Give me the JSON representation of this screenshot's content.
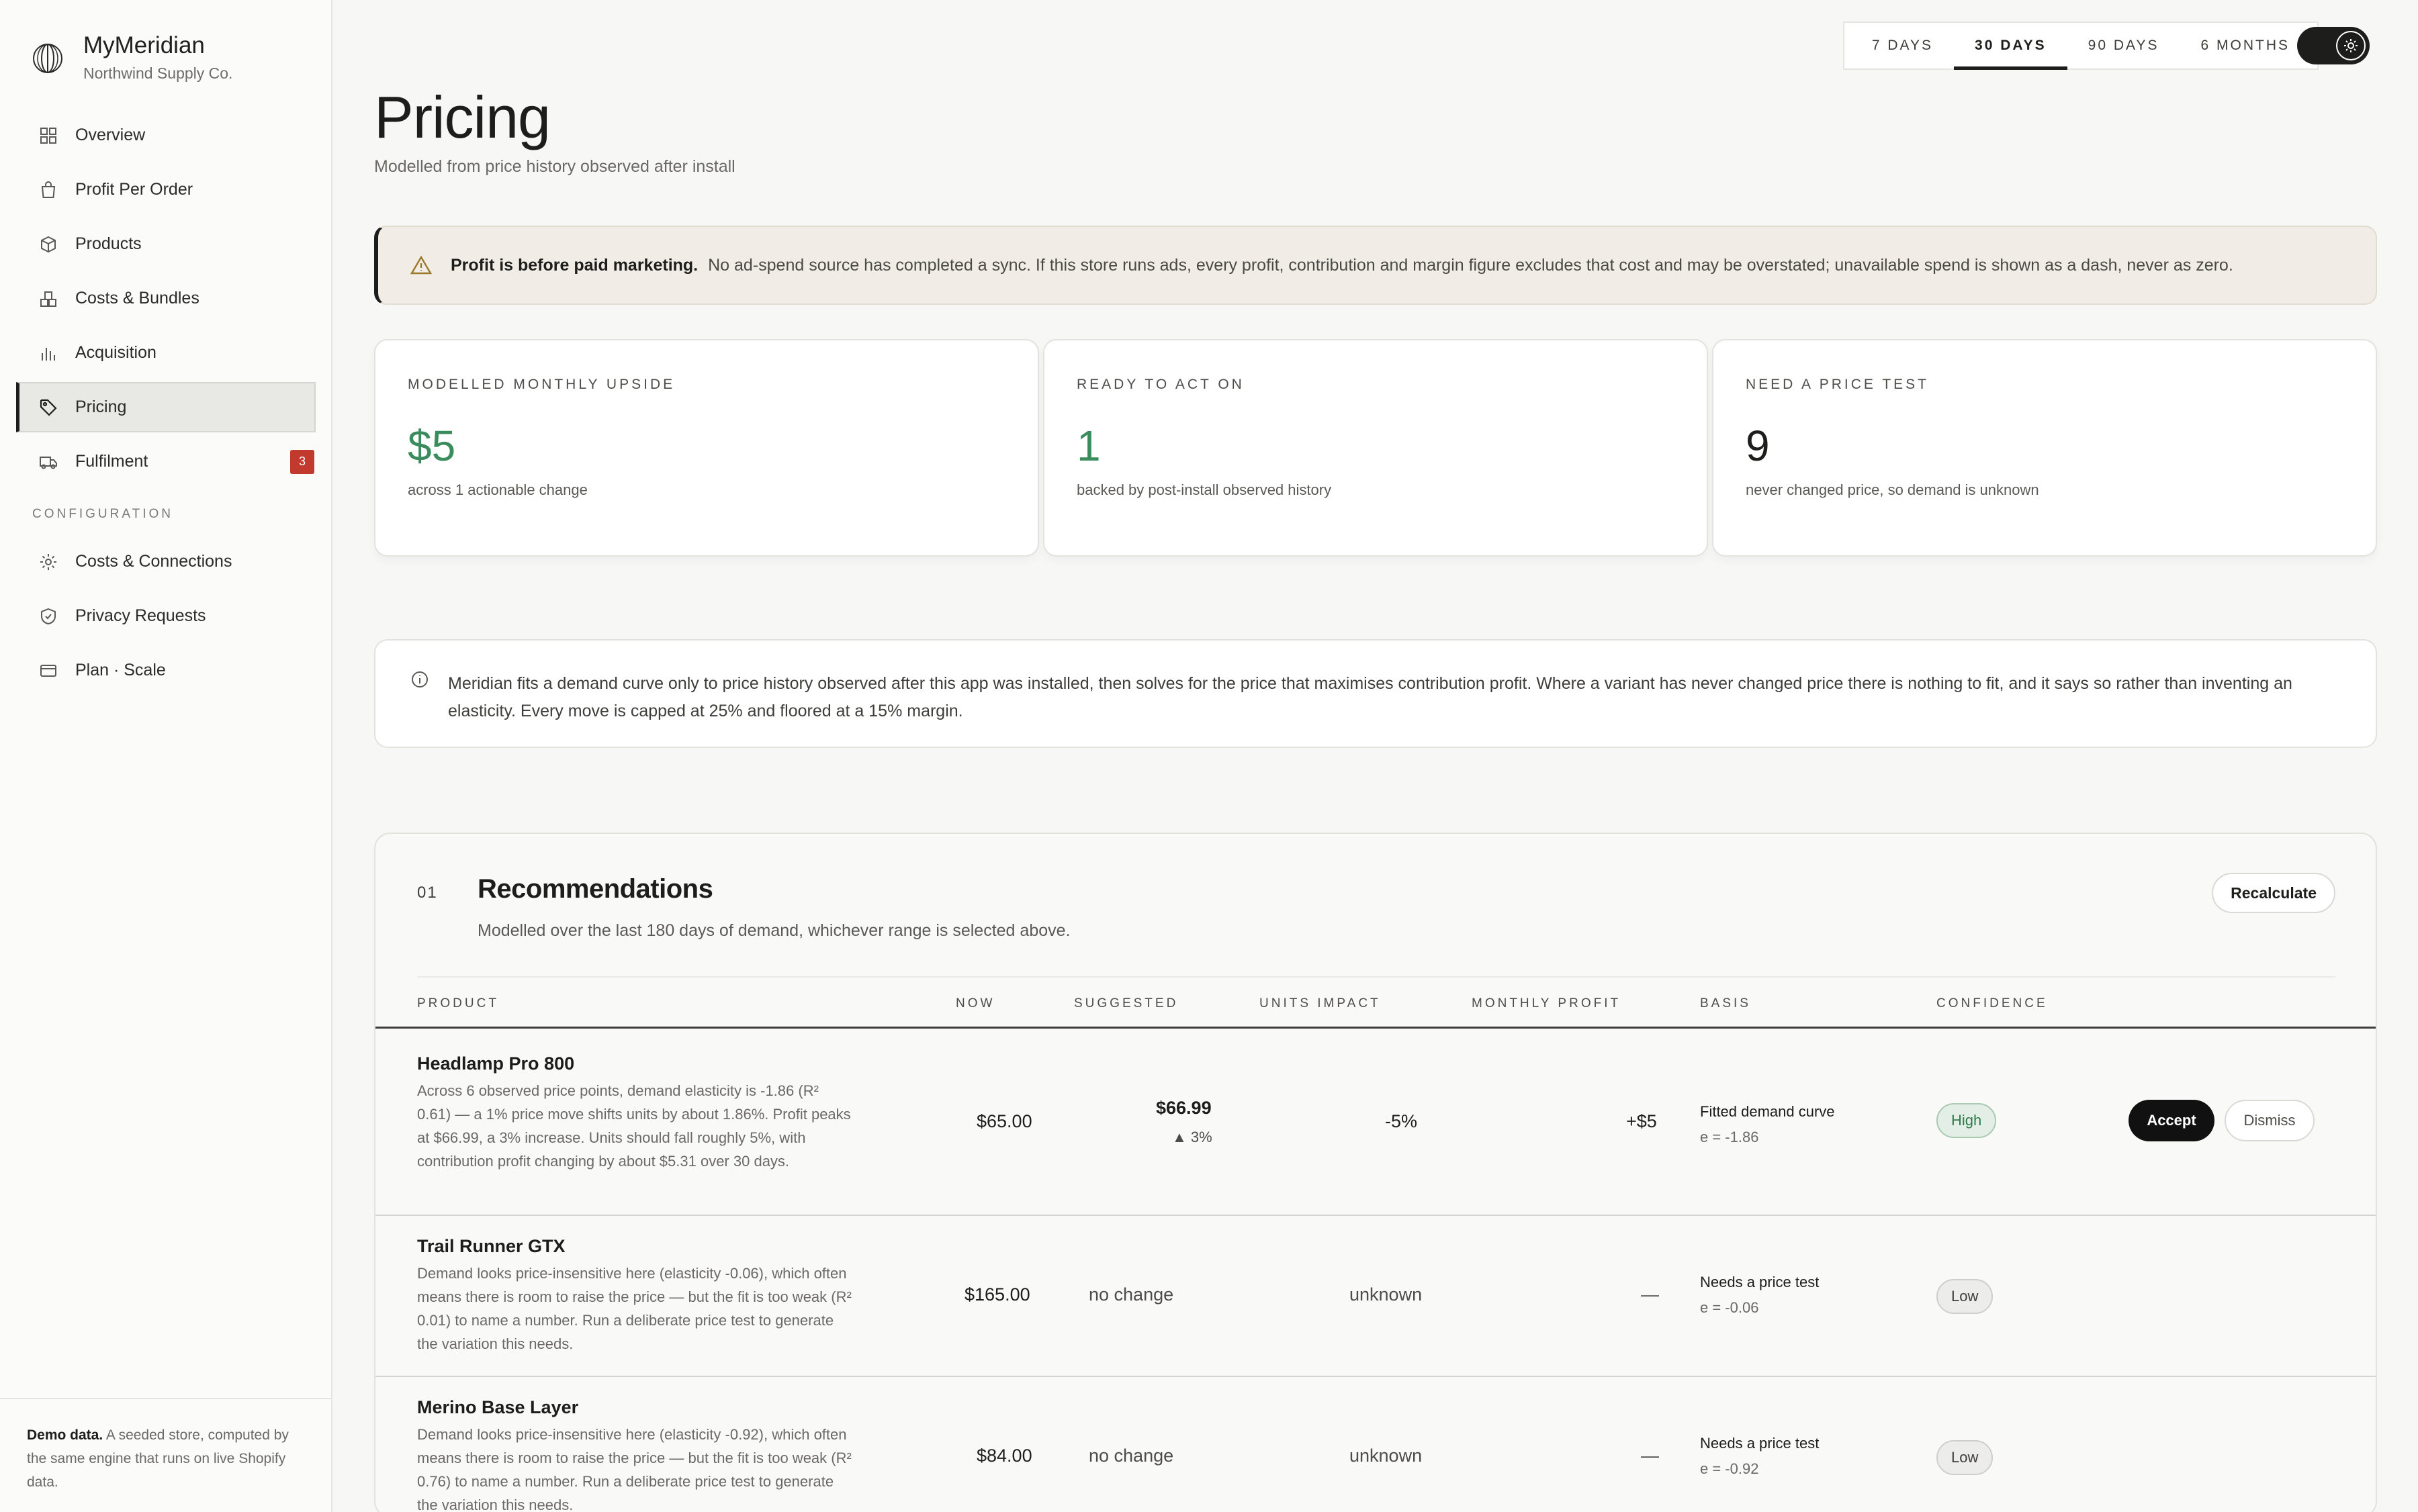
{
  "brand": {
    "name": "MyMeridian",
    "store": "Northwind Supply Co."
  },
  "nav": {
    "items": [
      {
        "label": "Overview",
        "icon": "grid-icon"
      },
      {
        "label": "Profit Per Order",
        "icon": "bag-icon"
      },
      {
        "label": "Products",
        "icon": "box-icon"
      },
      {
        "label": "Costs & Bundles",
        "icon": "stack-icon"
      },
      {
        "label": "Acquisition",
        "icon": "bars-icon"
      },
      {
        "label": "Pricing",
        "icon": "tag-icon",
        "active": true
      },
      {
        "label": "Fulfilment",
        "icon": "truck-icon",
        "badge": "3"
      }
    ],
    "config_label": "CONFIGURATION",
    "config_items": [
      {
        "label": "Costs & Connections",
        "icon": "gear-icon"
      },
      {
        "label": "Privacy Requests",
        "icon": "shield-icon"
      },
      {
        "label": "Plan · Scale",
        "icon": "card-icon"
      }
    ]
  },
  "demo": {
    "bold": "Demo data.",
    "text": "A seeded store, computed by the same engine that runs on live Shopify data."
  },
  "range": {
    "tabs": [
      "7 DAYS",
      "30 DAYS",
      "90 DAYS",
      "6 MONTHS"
    ],
    "selected": "30 DAYS"
  },
  "page": {
    "title": "Pricing",
    "subtitle": "Modelled from price history observed after install"
  },
  "alert": {
    "bold": "Profit is before paid marketing.",
    "text": "No ad-spend source has completed a sync. If this store runs ads, every profit, contribution and margin figure excludes that cost and may be overstated; unavailable spend is shown as a dash, never as zero."
  },
  "stats": [
    {
      "label": "MODELLED MONTHLY UPSIDE",
      "value": "$5",
      "note": "across 1 actionable change"
    },
    {
      "label": "READY TO ACT ON",
      "value": "1",
      "note": "backed by post-install observed history"
    },
    {
      "label": "NEED A PRICE TEST",
      "value": "9",
      "note": "never changed price, so demand is unknown"
    }
  ],
  "info": "Meridian fits a demand curve only to price history observed after this app was installed, then solves for the price that maximises contribution profit. Where a variant has never changed price there is nothing to fit, and it says so rather than inventing an elasticity. Every move is capped at 25% and floored at a 15% margin.",
  "recommendations": {
    "number": "01",
    "title": "Recommendations",
    "subtitle": "Modelled over the last 180 days of demand, whichever range is selected above.",
    "recalc_label": "Recalculate",
    "columns": [
      "PRODUCT",
      "NOW",
      "SUGGESTED",
      "UNITS IMPACT",
      "MONTHLY PROFIT",
      "BASIS",
      "CONFIDENCE"
    ],
    "rows": [
      {
        "name": "Headlamp Pro 800",
        "desc": "Across 6 observed price points, demand elasticity is -1.86 (R² 0.61) — a 1% price move shifts units by about 1.86%. Profit peaks at $66.99, a 3% increase. Units should fall roughly 5%, with contribution profit changing by about $5.31 over 30 days.",
        "now": "$65.00",
        "suggested": "$66.99",
        "change": "▲ 3%",
        "units": "-5%",
        "profit": "+$5",
        "basis": "Fitted demand curve",
        "elasticity": "e = -1.86",
        "confidence": "High",
        "accept_label": "Accept",
        "dismiss_label": "Dismiss"
      },
      {
        "name": "Trail Runner GTX",
        "desc": "Demand looks price-insensitive here (elasticity -0.06), which often means there is room to raise the price — but the fit is too weak (R² 0.01) to name a number. Run a deliberate price test to generate the variation this needs.",
        "now": "$165.00",
        "suggested": "no change",
        "units": "unknown",
        "profit": "—",
        "basis": "Needs a price test",
        "elasticity": "e = -0.06",
        "confidence": "Low"
      },
      {
        "name": "Merino Base Layer",
        "desc": "Demand looks price-insensitive here (elasticity -0.92), which often means there is room to raise the price — but the fit is too weak (R² 0.76) to name a number. Run a deliberate price test to generate the variation this needs.",
        "now": "$84.00",
        "suggested": "no change",
        "units": "unknown",
        "profit": "—",
        "basis": "Needs a price test",
        "elasticity": "e = -0.92",
        "confidence": "Low"
      }
    ]
  },
  "colors": {
    "accent": "#1d1d1b",
    "positive": "#3b8c5c",
    "badge": "#c2392e",
    "alert_bg": "#f1ede6"
  }
}
